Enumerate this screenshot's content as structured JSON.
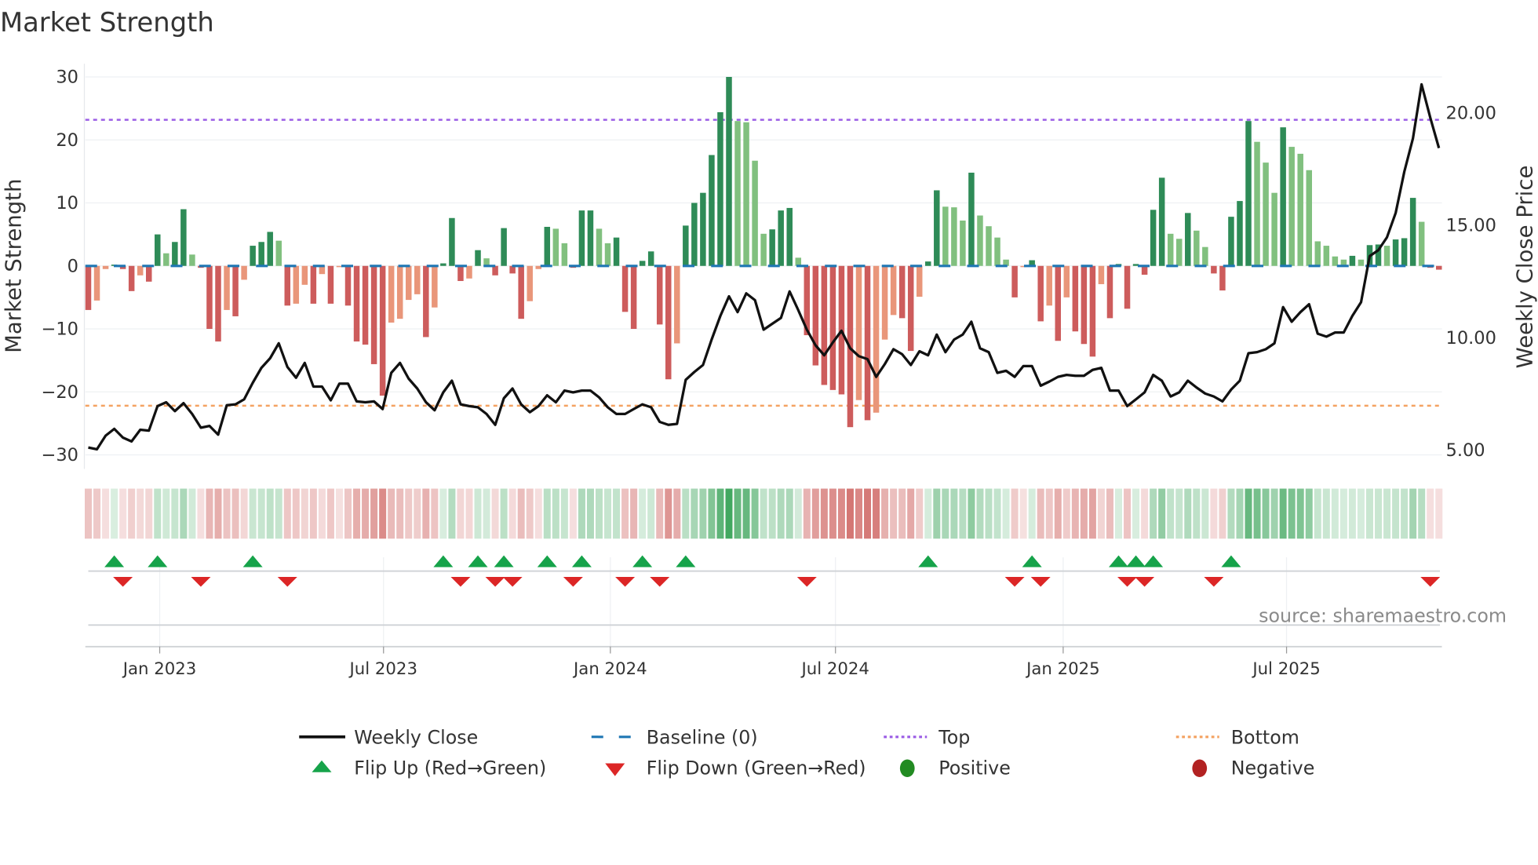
{
  "chart_data": {
    "type": "bar",
    "title": "Market Strength",
    "ylabel": "Market Strength",
    "y2label": "Weekly Close Price",
    "ylim": [
      -32,
      32
    ],
    "yticks": [
      -30,
      -20,
      -10,
      0,
      10,
      20,
      30
    ],
    "ytick_labels": [
      "−30",
      "−20",
      "−10",
      "0",
      "10",
      "20",
      "30"
    ],
    "y2lim": [
      4.3,
      22.2
    ],
    "y2ticks": [
      5,
      10,
      15,
      20
    ],
    "y2tick_labels": [
      "5.00",
      "10.00",
      "15.00",
      "20.00"
    ],
    "x_unit": "week index",
    "xticks": [
      {
        "label": "Jan 2023",
        "pos": 8.25
      },
      {
        "label": "Jul 2023",
        "pos": 34.1
      },
      {
        "label": "Jan 2024",
        "pos": 60.3
      },
      {
        "label": "Jul 2024",
        "pos": 86.3
      },
      {
        "label": "Jan 2025",
        "pos": 112.6
      },
      {
        "label": "Jul 2025",
        "pos": 138.4
      }
    ],
    "top_level": 23.2,
    "bottom_level": -22.2,
    "baseline": 0,
    "grid": true,
    "strength": [
      -7,
      -5.5,
      -0.5,
      0.2,
      -0.5,
      -4,
      -1.5,
      -2.5,
      5,
      2,
      3.8,
      9,
      1.8,
      -0.3,
      -10,
      -12,
      -7,
      -8,
      -2.2,
      3.2,
      3.8,
      5.4,
      4,
      -6.3,
      -6,
      -3,
      -6,
      -1.3,
      -6,
      -0.2,
      -6.3,
      -12,
      -12.5,
      -15.6,
      -20.6,
      -9,
      -8.4,
      -5.4,
      -4.5,
      -11.3,
      -6.6,
      0.4,
      7.6,
      -2.4,
      -2,
      2.5,
      1.2,
      -1.5,
      6,
      -1.2,
      -8.4,
      -5.6,
      -0.5,
      6.2,
      5.9,
      3.6,
      -0.3,
      8.8,
      8.8,
      5.9,
      3.6,
      4.5,
      -7.3,
      -10,
      0.8,
      2.3,
      -9.3,
      -18,
      -12.3,
      6.4,
      10,
      11.6,
      17.6,
      24.4,
      30,
      23,
      22.8,
      16.7,
      5.1,
      5.8,
      8.8,
      9.2,
      1.3,
      -11,
      -15.8,
      -18.9,
      -19.7,
      -20.4,
      -25.6,
      -21.3,
      -24.5,
      -23.3,
      -11.7,
      -7.8,
      -8.3,
      -13.5,
      -4.9,
      0.7,
      12,
      9.4,
      9.3,
      7.2,
      14.8,
      8,
      6.3,
      4.5,
      1,
      -5,
      -0.2,
      0.9,
      -8.8,
      -6.3,
      -11.9,
      -5,
      -10.4,
      -12.4,
      -14.4,
      -2.9,
      -8.3,
      0.3,
      -6.8,
      0.3,
      -1.4,
      8.9,
      14,
      5.1,
      4.3,
      8.4,
      5.6,
      3,
      -1.2,
      -3.9,
      7.8,
      10.3,
      23,
      19.7,
      16.4,
      11.6,
      22,
      18.9,
      17.8,
      15.2,
      3.9,
      3.2,
      1.5,
      1,
      1.6,
      1,
      3.3,
      3.4,
      3.2,
      4.2,
      4.4,
      10.8,
      7,
      -0.3,
      -0.6
    ],
    "weekly_close": [
      5.08,
      5.0,
      5.61,
      5.91,
      5.52,
      5.35,
      5.87,
      5.83,
      6.92,
      7.09,
      6.7,
      7.05,
      6.57,
      5.96,
      6.04,
      5.65,
      6.96,
      7.0,
      7.22,
      7.96,
      8.62,
      9.05,
      9.71,
      8.66,
      8.18,
      8.84,
      7.79,
      7.79,
      7.18,
      7.92,
      7.92,
      7.13,
      7.09,
      7.13,
      6.79,
      8.4,
      8.84,
      8.14,
      7.7,
      7.09,
      6.74,
      7.53,
      8.05,
      7.0,
      6.92,
      6.87,
      6.57,
      6.09,
      7.27,
      7.7,
      7.0,
      6.65,
      6.92,
      7.4,
      7.09,
      7.61,
      7.53,
      7.61,
      7.61,
      7.31,
      6.87,
      6.57,
      6.57,
      6.79,
      7.0,
      6.87,
      6.22,
      6.09,
      6.13,
      8.09,
      8.44,
      8.75,
      9.88,
      10.93,
      11.8,
      11.1,
      11.93,
      11.63,
      10.32,
      10.58,
      10.84,
      12.02,
      11.19,
      10.32,
      9.62,
      9.18,
      9.75,
      10.27,
      9.49,
      9.14,
      9.01,
      8.22,
      8.79,
      9.45,
      9.23,
      8.75,
      9.36,
      9.18,
      10.1,
      9.32,
      9.88,
      10.1,
      10.67,
      9.49,
      9.32,
      8.4,
      8.49,
      8.22,
      8.7,
      8.7,
      7.83,
      8.01,
      8.22,
      8.31,
      8.27,
      8.27,
      8.53,
      8.62,
      7.61,
      7.61,
      6.92,
      7.22,
      7.53,
      8.31,
      8.05,
      7.35,
      7.53,
      8.05,
      7.75,
      7.48,
      7.35,
      7.13,
      7.66,
      8.05,
      9.27,
      9.32,
      9.45,
      9.71,
      11.32,
      10.67,
      11.1,
      11.45,
      10.14,
      10.01,
      10.19,
      10.19,
      10.93,
      11.54,
      13.59,
      13.85,
      14.42,
      15.51,
      17.34,
      18.82,
      21.22,
      19.74,
      18.39
    ],
    "colors": {
      "pos_strong": "#2e8b57",
      "pos_weak": "#81c07f",
      "neg_strong": "#cd5c5c",
      "neg_weak": "#e9967a",
      "close": "#111111",
      "baseline": "#1f77b4",
      "top": "#9b5de5",
      "bottom": "#f4a261",
      "flip_up": "#16a34a",
      "flip_down": "#dc2626",
      "positive": "#228b22",
      "negative": "#b22222",
      "heat_pos": "#2e9e4f",
      "heat_neg": "#c9524f"
    },
    "legend": {
      "placement": "bottom",
      "weekly_close": "Weekly Close",
      "baseline": "Baseline (0)",
      "top": "Top",
      "bottom": "Bottom",
      "flip_up": "Flip Up (Red→Green)",
      "flip_down": "Flip Down (Green→Red)",
      "positive": "Positive",
      "negative": "Negative"
    },
    "source": "source: sharemaestro.com"
  }
}
